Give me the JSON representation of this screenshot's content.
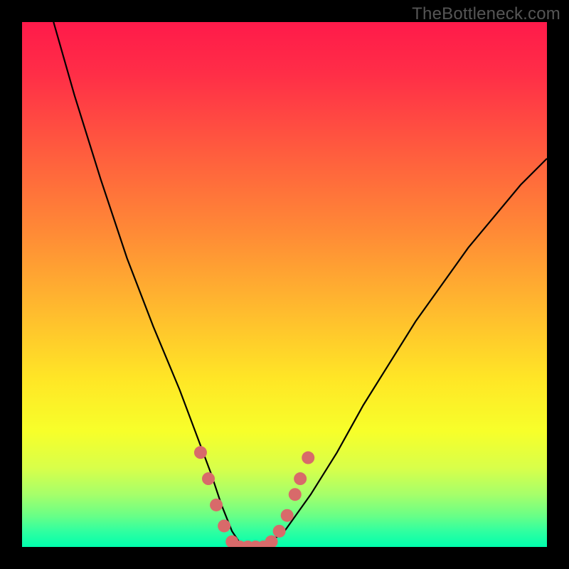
{
  "watermark": "TheBottleneck.com",
  "chart_data": {
    "type": "line",
    "title": "",
    "xlabel": "",
    "ylabel": "",
    "xlim": [
      0,
      100
    ],
    "ylim": [
      0,
      100
    ],
    "gradient_note": "vertical gradient background from red (top) through orange/yellow to bright green (bottom)",
    "series": [
      {
        "name": "bottleneck-curve",
        "color": "#000000",
        "x": [
          6,
          10,
          15,
          20,
          25,
          30,
          33,
          36,
          38,
          40,
          42,
          44,
          46,
          50,
          55,
          60,
          65,
          70,
          75,
          80,
          85,
          90,
          95,
          100
        ],
        "y": [
          100,
          86,
          70,
          55,
          42,
          30,
          22,
          14,
          8,
          3,
          0,
          0,
          0,
          3,
          10,
          18,
          27,
          35,
          43,
          50,
          57,
          63,
          69,
          74
        ]
      }
    ],
    "markers": {
      "name": "highlight-points",
      "color": "#d86a6a",
      "points_xy": [
        [
          34,
          18
        ],
        [
          35.5,
          13
        ],
        [
          37,
          8
        ],
        [
          38.5,
          4
        ],
        [
          40,
          1
        ],
        [
          41.5,
          0
        ],
        [
          43,
          0
        ],
        [
          44.5,
          0
        ],
        [
          46,
          0
        ],
        [
          47.5,
          1
        ],
        [
          49,
          3
        ],
        [
          50.5,
          6
        ],
        [
          52,
          10
        ],
        [
          53,
          13
        ],
        [
          54.5,
          17
        ]
      ]
    }
  }
}
